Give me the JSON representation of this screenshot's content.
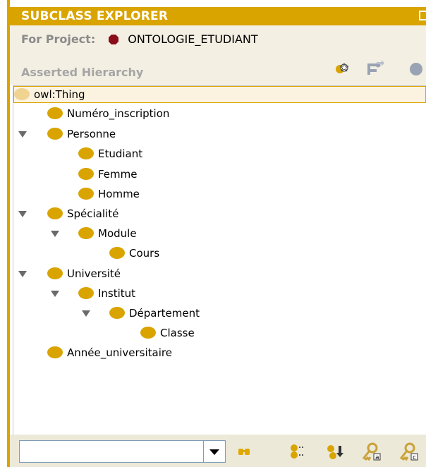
{
  "panel": {
    "title": "SUBCLASS EXPLORER",
    "project_label": "For Project:",
    "project_name": "ONTOLOGIE_ETUDIANT",
    "hierarchy_label": "Asserted Hierarchy"
  },
  "tree": {
    "root": "owl:Thing",
    "items": {
      "numero_inscription": "Numéro_inscription",
      "personne": "Personne",
      "etudiant": "Etudiant",
      "femme": "Femme",
      "homme": "Homme",
      "specialite": "Spécialité",
      "module": "Module",
      "cours": "Cours",
      "universite": "Université",
      "institut": "Institut",
      "departement": "Département",
      "classe": "Classe",
      "annee_universitaire": "Année_universitaire"
    }
  },
  "search": {
    "value": ""
  },
  "icons": {
    "title": "maximize-icon",
    "project": "project-icon",
    "toolbar": [
      "create-subclass-icon",
      "create-sibling-class-icon",
      "delete-class-icon"
    ],
    "bottom": [
      "binoculars-icon",
      "show-hierarchy-icon",
      "add-superclass-icon",
      "key-icon",
      "key-c-icon"
    ]
  },
  "colors": {
    "accent": "#d9a400",
    "class_dot": "#d9a400",
    "root_dot": "#f0d391",
    "project_icon": "#8b0d1a",
    "panel_bg": "#f3efe3",
    "bottom_bar": "#ece9d8"
  }
}
